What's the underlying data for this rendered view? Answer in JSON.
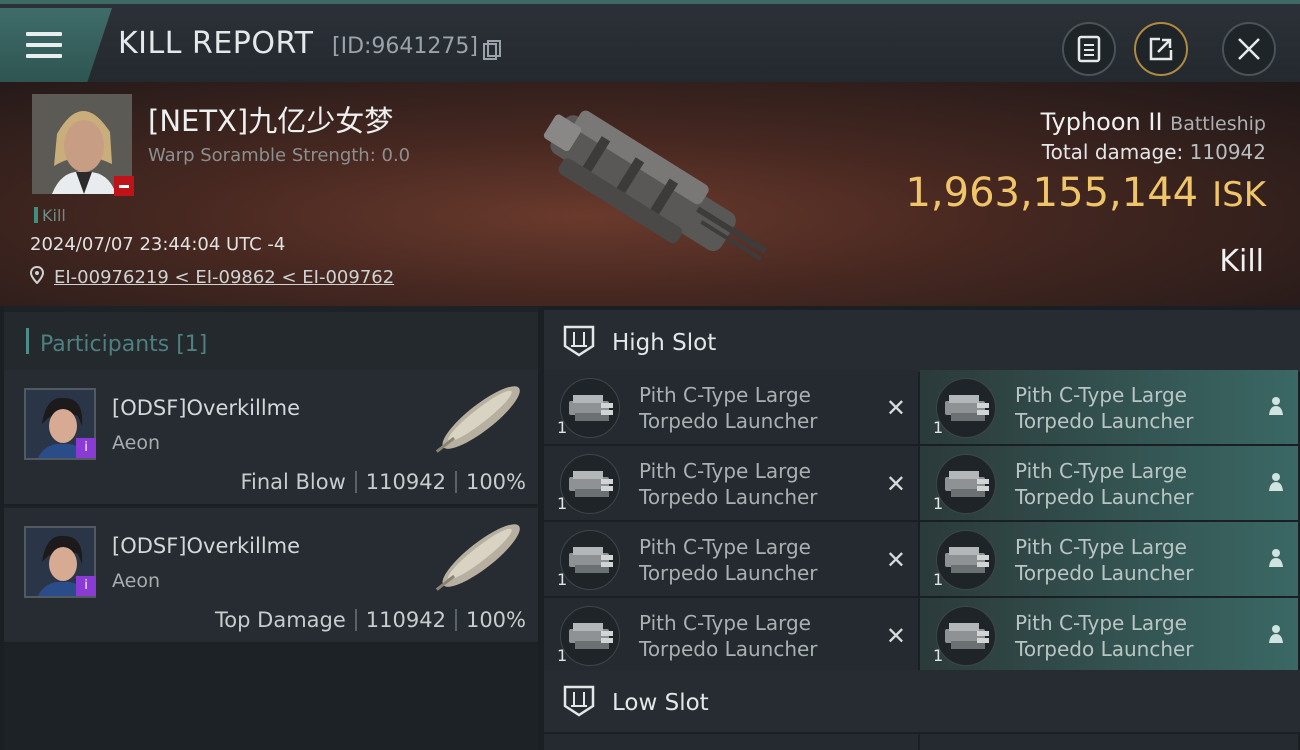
{
  "header": {
    "title": "KILL REPORT",
    "id_text": "[ID:9641275]"
  },
  "victim": {
    "name": "[NETX]九亿少女梦",
    "warp_scramble": "Warp Soramble Strength: 0.0",
    "kill_tag": "Kill",
    "datetime": "2024/07/07 23:44:04 UTC -4",
    "location": "EI-00976219 < EI-09862 < EI-009762",
    "ship_name": "Typhoon II",
    "ship_class": "Battleship",
    "total_damage_label": "Total damage:",
    "total_damage_value": "110942",
    "isk_value": "1,963,155,144",
    "isk_unit": "ISK",
    "result": "Kill"
  },
  "participants": {
    "header": "Participants [1]",
    "rows": [
      {
        "name": "[ODSF]Overkillme",
        "corp": "Aeon",
        "role": "Final Blow",
        "damage": "110942",
        "percent": "100%"
      },
      {
        "name": "[ODSF]Overkillme",
        "corp": "Aeon",
        "role": "Top Damage",
        "damage": "110942",
        "percent": "100%"
      }
    ]
  },
  "fitting": {
    "high_slot_title": "High Slot",
    "low_slot_title": "Low Slot",
    "high_slots": [
      {
        "line1": "Pith C-Type Large",
        "line2": "Torpedo Launcher",
        "qty": "1",
        "status": "destroyed"
      },
      {
        "line1": "Pith C-Type Large",
        "line2": "Torpedo Launcher",
        "qty": "1",
        "status": "dropped"
      },
      {
        "line1": "Pith C-Type Large",
        "line2": "Torpedo Launcher",
        "qty": "1",
        "status": "destroyed"
      },
      {
        "line1": "Pith C-Type Large",
        "line2": "Torpedo Launcher",
        "qty": "1",
        "status": "dropped"
      },
      {
        "line1": "Pith C-Type Large",
        "line2": "Torpedo Launcher",
        "qty": "1",
        "status": "destroyed"
      },
      {
        "line1": "Pith C-Type Large",
        "line2": "Torpedo Launcher",
        "qty": "1",
        "status": "dropped"
      },
      {
        "line1": "Pith C-Type Large",
        "line2": "Torpedo Launcher",
        "qty": "1",
        "status": "destroyed"
      },
      {
        "line1": "Pith C-Type Large",
        "line2": "Torpedo Launcher",
        "qty": "1",
        "status": "dropped"
      }
    ]
  },
  "colors": {
    "isk_gold": "#f0c569",
    "dropped_teal": "#3a6864",
    "accent_teal": "#4f8c8a"
  },
  "icons": {
    "menu": "hamburger-icon",
    "copy": "copy-icon",
    "clipboard": "clipboard-icon",
    "share": "share-icon",
    "close": "close-icon",
    "location": "location-pin-icon",
    "slot": "high-slot-icon",
    "destroyed": "x-icon",
    "dropped": "person-icon"
  }
}
